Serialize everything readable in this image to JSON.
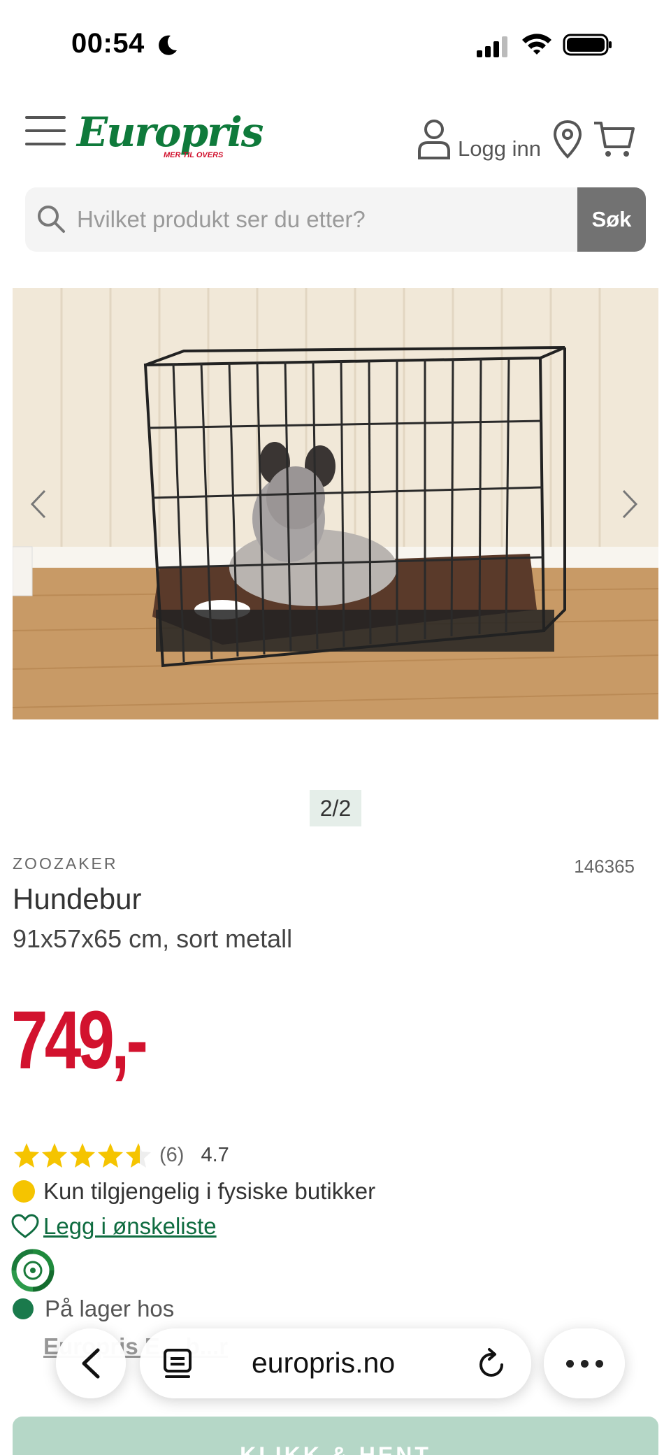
{
  "status_bar": {
    "time": "00:54",
    "icons": [
      "moon-icon",
      "signal-icon",
      "wifi-icon",
      "battery-icon"
    ]
  },
  "header": {
    "logo_text": "Europris",
    "logo_tagline": "MER TIL OVERS",
    "login_label": "Logg inn",
    "icons": [
      "menu-icon",
      "user-icon",
      "location-pin-icon",
      "cart-icon"
    ]
  },
  "search": {
    "placeholder": "Hvilket produkt ser du etter?",
    "button_label": "Søk"
  },
  "gallery": {
    "pager": "2/2"
  },
  "product": {
    "brand": "ZOOZAKER",
    "sku": "146365",
    "title": "Hundebur",
    "subtitle": "91x57x65 cm, sort metall",
    "price": "749,-",
    "rating_stars": 4.5,
    "rating_count": "(6)",
    "rating_value": "4.7",
    "availability": "Kun tilgjengelig i fysiske butikker",
    "wishlist_label": "Legg i ønskeliste",
    "stock_label": "På lager hos",
    "store_link": "Europris E... b...r",
    "click_collect_label": "KLIKK & HENT"
  },
  "browser": {
    "url": "europris.no"
  },
  "colors": {
    "brand_green": "#0f7a3b",
    "price_red": "#d2122e",
    "star_yellow": "#f5c400",
    "button_grey": "#727272"
  }
}
